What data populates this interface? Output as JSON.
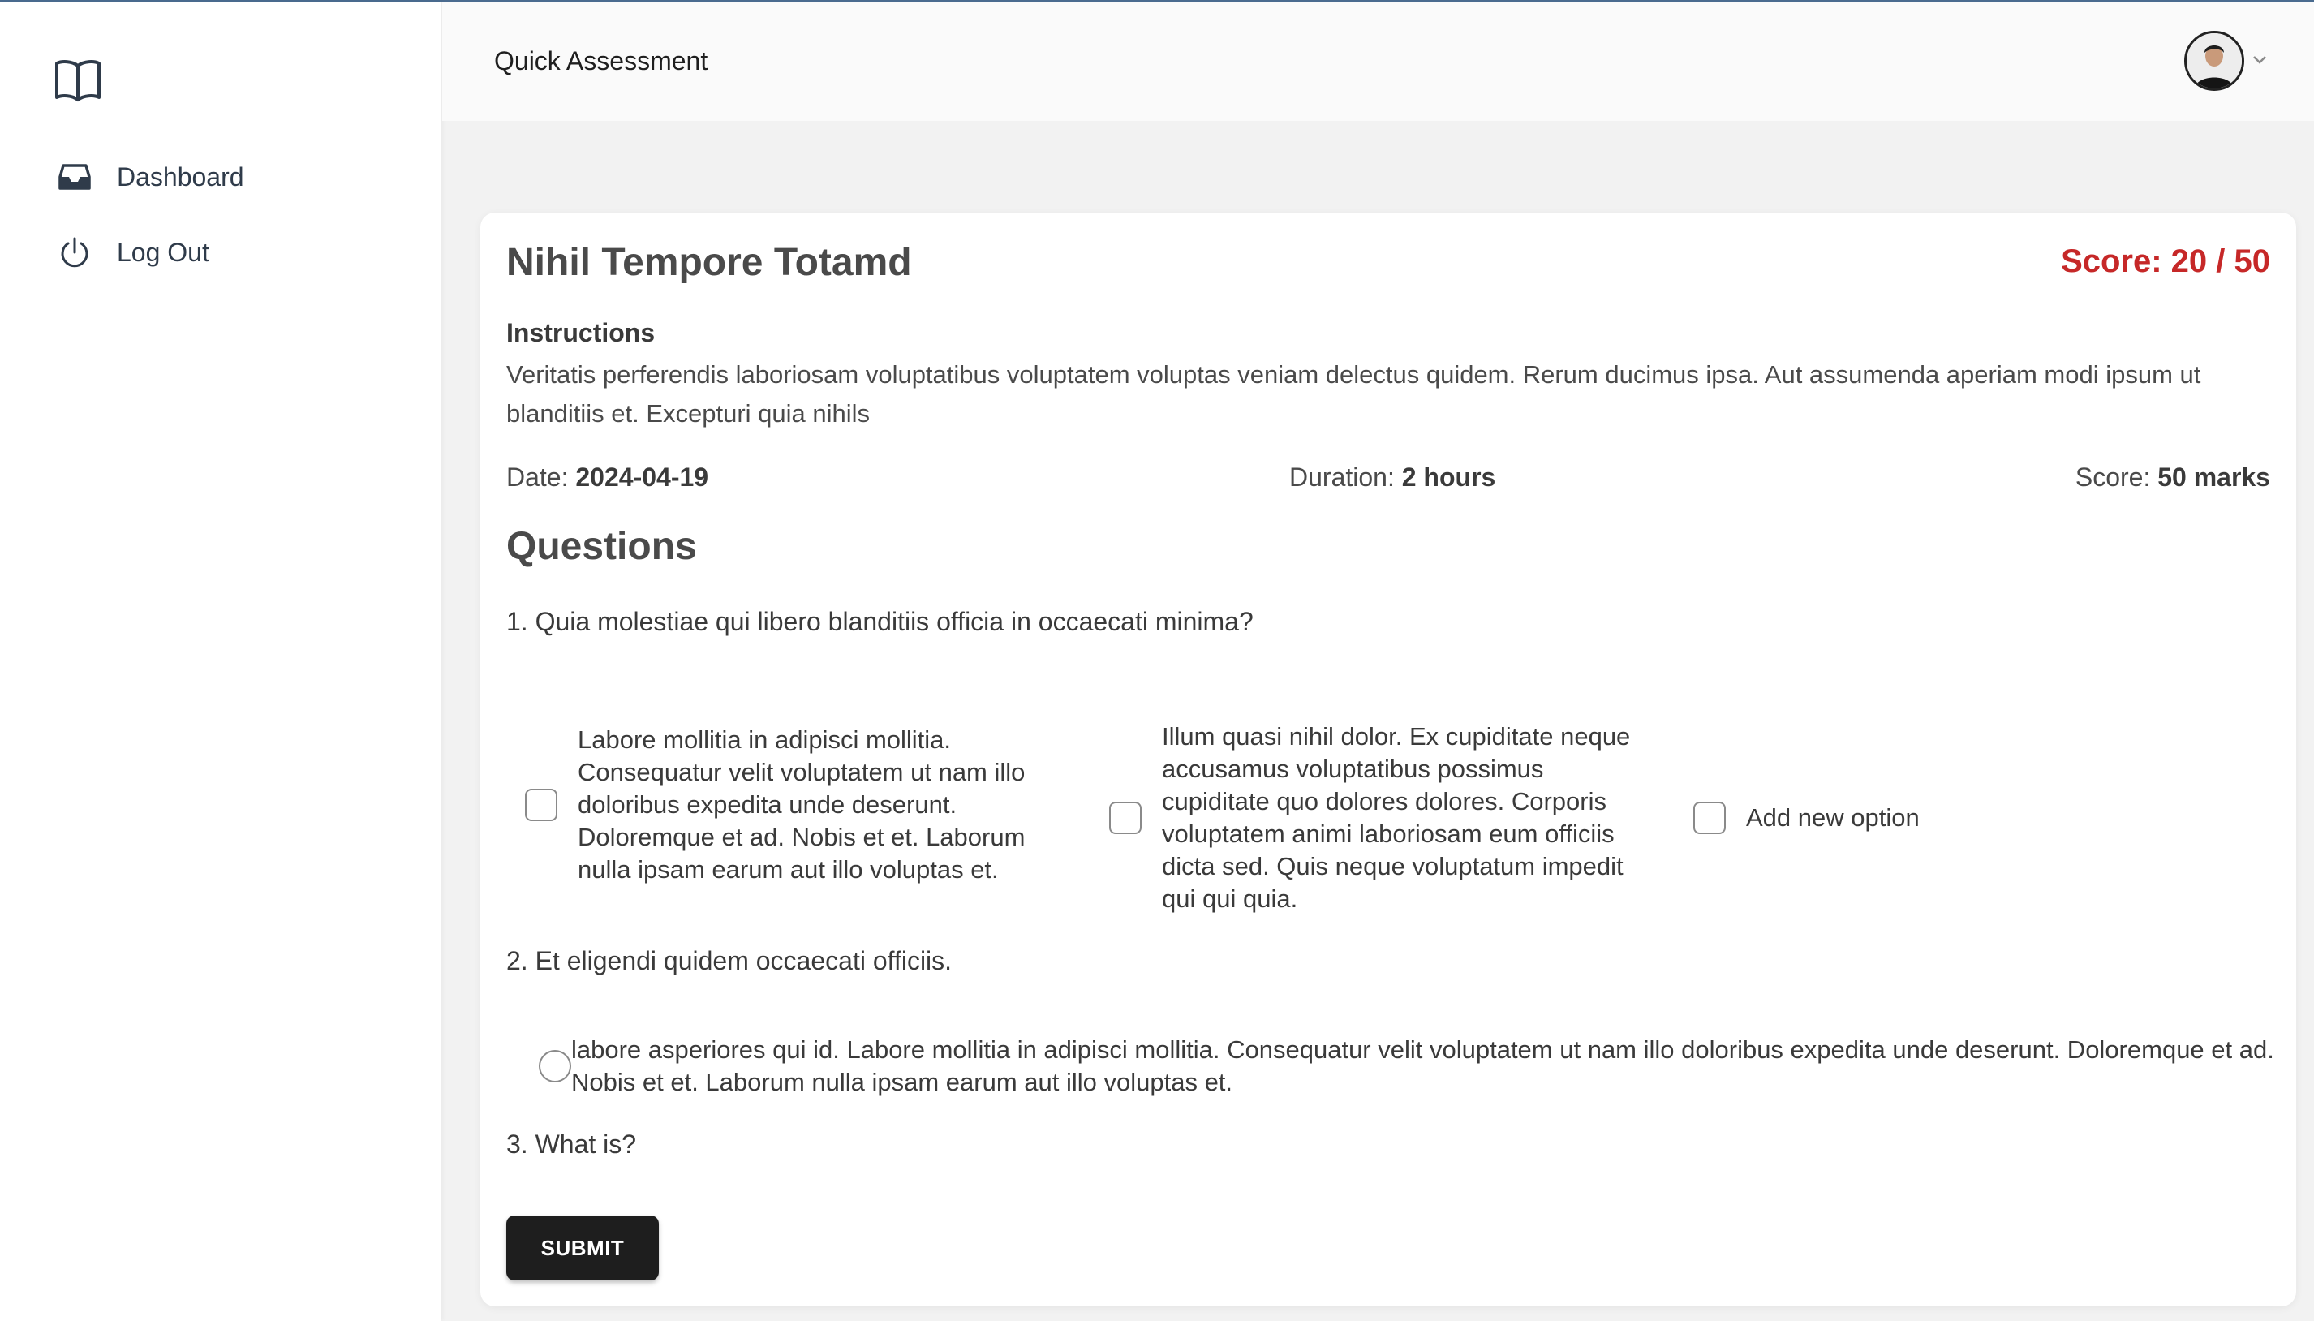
{
  "header": {
    "title": "Quick Assessment"
  },
  "sidebar": {
    "logo_icon": "book-open-icon",
    "items": [
      {
        "label": "Dashboard",
        "icon": "inbox-icon"
      },
      {
        "label": "Log Out",
        "icon": "power-icon"
      }
    ]
  },
  "user": {
    "avatar_icon": "avatar",
    "menu_icon": "chevron-down-icon"
  },
  "assessment": {
    "title": "Nihil Tempore Totamd",
    "score_display": "Score: 20 / 50",
    "score_color": "#c62828",
    "instructions_label": "Instructions",
    "instructions": "Veritatis perferendis laboriosam voluptatibus voluptatem voluptas veniam delectus quidem. Rerum ducimus ipsa. Aut assumenda aperiam modi ipsum ut blanditiis et. Excepturi quia nihils",
    "date_label": "Date:",
    "date": "2024-04-19",
    "duration_label": "Duration:",
    "duration": "2 hours",
    "marks_label": "Score:",
    "marks": "50 marks"
  },
  "questions_heading": "Questions",
  "questions": [
    {
      "text": "1.  Quia molestiae qui libero blanditiis officia in occaecati minima?",
      "options": [
        "Labore mollitia in adipisci mollitia. Consequatur velit voluptatem ut nam illo doloribus expedita unde deserunt. Doloremque et ad. Nobis et et. Laborum nulla ipsam earum aut illo voluptas et.",
        "Illum quasi nihil dolor. Ex cupiditate neque accusamus voluptatibus possimus cupiditate quo dolores dolores. Corporis voluptatem animi laboriosam eum officiis dicta sed. Quis neque voluptatum impedit qui qui quia.",
        "Add new option"
      ]
    },
    {
      "text": "2.  Et eligendi quidem occaecati officiis.",
      "options": [
        "labore asperiores qui id. Labore mollitia in adipisci mollitia. Consequatur velit voluptatem ut nam illo doloribus expedita unde deserunt. Doloremque et ad. Nobis et et. Laborum nulla ipsam earum aut illo voluptas et."
      ]
    },
    {
      "text": "3.  What is?"
    }
  ],
  "submit_label": "SUBMIT"
}
